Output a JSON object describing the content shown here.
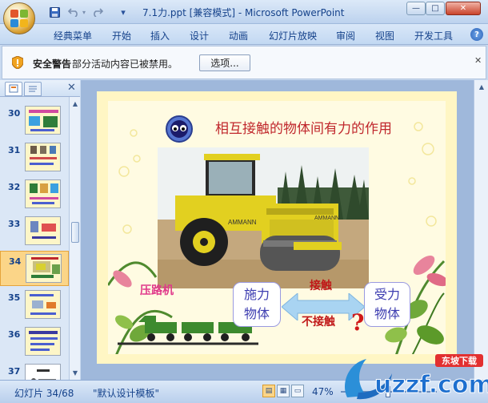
{
  "window": {
    "title": "7.1力.ppt [兼容模式] - Microsoft PowerPoint",
    "minimize": "—",
    "maximize": "□",
    "close": "✕"
  },
  "quick_access": {
    "save_icon": "save-icon",
    "undo_icon": "undo-icon",
    "redo_icon": "redo-icon",
    "customize": "▾"
  },
  "ribbon": {
    "tabs": [
      "经典菜单",
      "开始",
      "插入",
      "设计",
      "动画",
      "幻灯片放映",
      "审阅",
      "视图",
      "开发工具"
    ],
    "help": "?"
  },
  "security_bar": {
    "title": "安全警告",
    "message": "部分活动内容已被禁用。",
    "button": "选项...",
    "close": "✕"
  },
  "slide_panel": {
    "close": "✕",
    "slides": [
      {
        "number": "30",
        "active": false
      },
      {
        "number": "31",
        "active": false
      },
      {
        "number": "32",
        "active": false
      },
      {
        "number": "33",
        "active": false
      },
      {
        "number": "34",
        "active": true
      },
      {
        "number": "35",
        "active": false
      },
      {
        "number": "36",
        "active": false
      },
      {
        "number": "37",
        "active": false
      }
    ]
  },
  "slide": {
    "title": "相互接触的物体间有力的作用",
    "caption": "压路机",
    "box_left": [
      "施力",
      "物体"
    ],
    "box_right": [
      "受力",
      "物体"
    ],
    "contact_label": "接触",
    "noncontact_label": "不接触",
    "question_mark": "?",
    "roller_brand": "AMMANN"
  },
  "status_bar": {
    "slide_indicator": "幻灯片 34/68",
    "template": "\"默认设计模板\"",
    "zoom": "47%",
    "zoom_level": 0.47
  },
  "watermark": {
    "text": "uzzf.com",
    "badge": "东坡下载"
  },
  "colors": {
    "title_red": "#c0282d",
    "caption_pink": "#e0388a",
    "box_blue": "#3c3cb0",
    "selected_thumb": "#fbd588"
  }
}
